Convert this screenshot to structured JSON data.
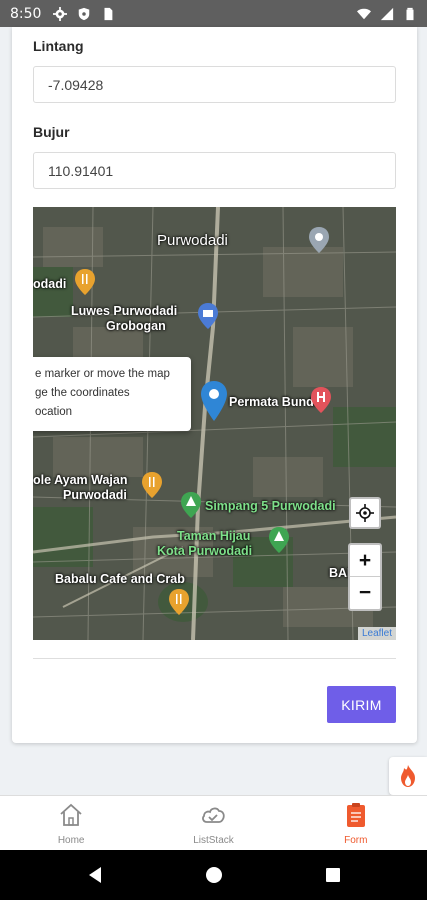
{
  "status_bar": {
    "time": "8:50"
  },
  "form": {
    "latitude_label": "Lintang",
    "latitude_value": "-7.09428",
    "longitude_label": "Bujur",
    "longitude_value": "110.91401",
    "submit_label": "KIRIM"
  },
  "map": {
    "labels": {
      "city": "Purwodadi",
      "restaurant_left": "odadi",
      "luwes_line1": "Luwes Purwodadi",
      "luwes_line2": "Grobogan",
      "hospital": "Permata Bunda",
      "ayam_line1": "ole Ayam Wajan",
      "ayam_line2": "Purwodadi",
      "simpang": "Simpang 5 Purwodadi",
      "taman_line1": "Taman Hijau",
      "taman_line2": "Kota Purwodadi",
      "babalu": "Babalu Cafe and Crab",
      "edge": "BAN"
    },
    "popup_lines": [
      "e marker or move the map",
      "ge the coordinates",
      "ocation"
    ],
    "zoom_in": "+",
    "zoom_out": "−",
    "attribution": "Leaflet"
  },
  "tabs": [
    {
      "label": "Home",
      "icon": "home-icon",
      "active": false
    },
    {
      "label": "ListStack",
      "icon": "cloud-check-icon",
      "active": false
    },
    {
      "label": "Form",
      "icon": "clipboard-icon",
      "active": true
    }
  ],
  "colors": {
    "accent": "#6f5ee8",
    "active_tab": "#ef5a2e",
    "marker": "#2f86d6"
  }
}
